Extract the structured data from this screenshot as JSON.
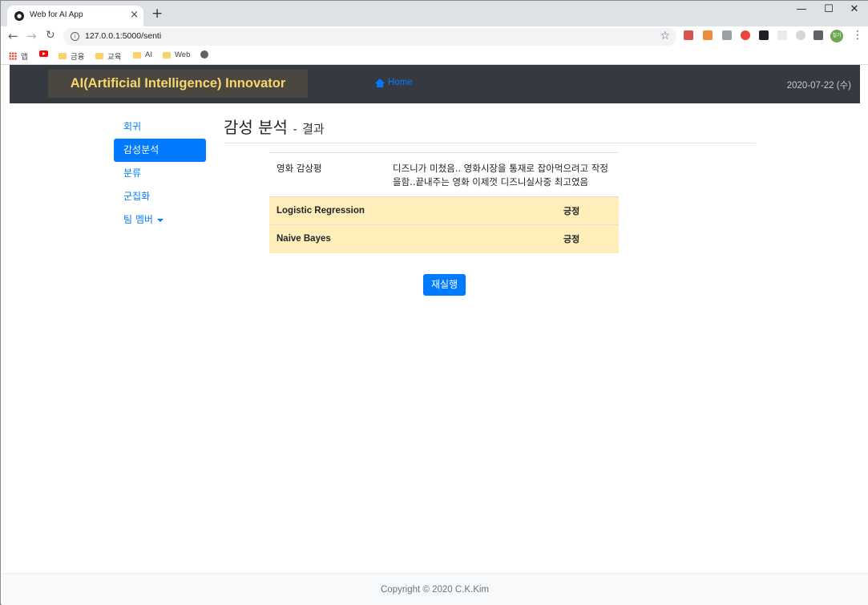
{
  "browser": {
    "tab_title": "Web for AI App",
    "url": "127.0.0.1:5000/senti",
    "bookmarks": [
      "앱",
      "금융",
      "교육",
      "AI",
      "Web"
    ],
    "profile_label": "철기"
  },
  "navbar": {
    "brand": "AI(Artificial Intelligence) Innovator",
    "home_label": "Home",
    "date": "2020-07-22 (수)"
  },
  "sidebar": {
    "items": [
      {
        "label": "회귀",
        "active": false
      },
      {
        "label": "감성분석",
        "active": true
      },
      {
        "label": "분류",
        "active": false
      },
      {
        "label": "군집화",
        "active": false
      },
      {
        "label": "팀 멤버",
        "active": false,
        "dropdown": true
      }
    ]
  },
  "main": {
    "title": "감성 분석",
    "title_separator": "-",
    "subtitle": "결과",
    "review_label": "영화 감상평",
    "review_text": "디즈니가 미쳤음.. 영화시장을 통재로 잡아먹으려고 작정을함..끝내주는 영화 이제껏 디즈니실사중 최고였음",
    "models": [
      {
        "name": "Logistic Regression",
        "result": "긍정"
      },
      {
        "name": "Naive Bayes",
        "result": "긍정"
      }
    ],
    "rerun_label": "재실행"
  },
  "footer": {
    "copyright": "Copyright © 2020 C.K.Kim"
  },
  "colors": {
    "navbar_bg": "#343a40",
    "brand_text": "#f5d76e",
    "primary": "#007bff",
    "warning_row": "#ffeeba"
  }
}
